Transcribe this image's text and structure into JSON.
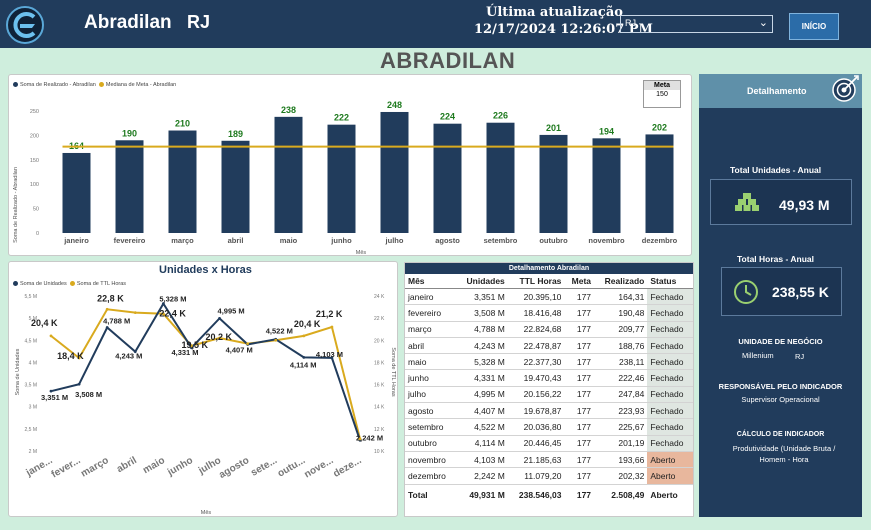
{
  "header": {
    "company": "Abradilan",
    "uf": "RJ",
    "update_label": "Última atualização",
    "update_value": "12/17/2024 12:26:07 PM",
    "filter_value": "RJ",
    "home_button": "INÍCIO"
  },
  "page_title": "ABRADILAN",
  "chart_data": [
    {
      "type": "bar",
      "legend": [
        "Soma de Realizado - Abradilan",
        "Mediana de Meta - Abradilan"
      ],
      "ylabel": "Soma de Realizado - Abradilan",
      "xlabel": "Mês",
      "y_ticks": [
        "0",
        "50",
        "100",
        "150",
        "200",
        "250"
      ],
      "ylim": [
        0,
        250
      ],
      "categories": [
        "janeiro",
        "fevereiro",
        "março",
        "abril",
        "maio",
        "junho",
        "julho",
        "agosto",
        "setembro",
        "outubro",
        "novembro",
        "dezembro"
      ],
      "values": [
        164,
        190,
        210,
        189,
        238,
        222,
        248,
        224,
        226,
        201,
        194,
        202
      ],
      "median_meta": 177,
      "meta_box_label": "Meta",
      "meta_box_value": "150",
      "colors": {
        "bar": "#213c5c",
        "line": "#d9aa1e",
        "label": "#1e7a1e"
      }
    },
    {
      "type": "line",
      "title": "Unidades x Horas",
      "legend": [
        "Soma de Unidades",
        "Soma de TTL Horas"
      ],
      "ylabel_left": "Soma de Unidades",
      "ylabel_right": "Soma de TTL Horas",
      "xlabel": "Mês",
      "y_left_ticks": [
        "2 M",
        "2,5 M",
        "3 M",
        "3,5 M",
        "4 M",
        "4,5 M",
        "5 M",
        "5,5 M"
      ],
      "y_right_ticks": [
        "10 K",
        "12 K",
        "14 K",
        "16 K",
        "18 K",
        "20 K",
        "22 K",
        "24 K"
      ],
      "ylim_left": [
        2.0,
        5.5
      ],
      "ylim_right": [
        10,
        24
      ],
      "x_ticks": [
        "jane...",
        "fever...",
        "março",
        "abril",
        "maio",
        "junho",
        "julho",
        "agosto",
        "sete...",
        "outu...",
        "nove...",
        "deze..."
      ],
      "series": [
        {
          "name": "Soma de Unidades",
          "values": [
            3.351,
            3.508,
            4.788,
            4.243,
            5.328,
            4.331,
            4.995,
            4.407,
            4.522,
            4.114,
            4.103,
            2.242
          ],
          "labels": [
            "3,351 M",
            "3,508 M",
            "4,788 M",
            "4,243 M",
            "5,328 M",
            "4,331 M",
            "4,995 M",
            "4,407 M",
            "4,522 M",
            "4,114 M",
            "4,103 M",
            "2,242 M"
          ],
          "color": "#213c5c"
        },
        {
          "name": "Soma de TTL Horas",
          "values": [
            20.4,
            18.4,
            22.8,
            22.5,
            22.4,
            19.5,
            20.2,
            19.7,
            20.0,
            20.4,
            21.2,
            11.1
          ],
          "labels": [
            "20,4 K",
            "18,4 K",
            "22,8 K",
            "",
            "22,4 K",
            "19,5 K",
            "20,2 K",
            "",
            "",
            "20,4 K",
            "21,2 K",
            ""
          ],
          "color": "#d9aa1e"
        }
      ]
    }
  ],
  "table": {
    "title": "Detalhamento Abradilan",
    "headers": [
      "Mês",
      "Unidades",
      "TTL Horas",
      "Meta",
      "Realizado",
      "Status"
    ],
    "rows": [
      [
        "janeiro",
        "3,351 M",
        "20.395,10",
        "177",
        "164,31",
        "Fechado"
      ],
      [
        "fevereiro",
        "3,508 M",
        "18.416,48",
        "177",
        "190,48",
        "Fechado"
      ],
      [
        "março",
        "4,788 M",
        "22.824,68",
        "177",
        "209,77",
        "Fechado"
      ],
      [
        "abril",
        "4,243 M",
        "22.478,87",
        "177",
        "188,76",
        "Fechado"
      ],
      [
        "maio",
        "5,328 M",
        "22.377,30",
        "177",
        "238,11",
        "Fechado"
      ],
      [
        "junho",
        "4,331 M",
        "19.470,43",
        "177",
        "222,46",
        "Fechado"
      ],
      [
        "julho",
        "4,995 M",
        "20.156,22",
        "177",
        "247,84",
        "Fechado"
      ],
      [
        "agosto",
        "4,407 M",
        "19.678,87",
        "177",
        "223,93",
        "Fechado"
      ],
      [
        "setembro",
        "4,522 M",
        "20.036,80",
        "177",
        "225,67",
        "Fechado"
      ],
      [
        "outubro",
        "4,114 M",
        "20.446,45",
        "177",
        "201,19",
        "Fechado"
      ],
      [
        "novembro",
        "4,103 M",
        "21.185,63",
        "177",
        "193,66",
        "Aberto"
      ],
      [
        "dezembro",
        "2,242 M",
        "11.079,20",
        "177",
        "202,32",
        "Aberto"
      ]
    ],
    "total": [
      "Total",
      "49,931 M",
      "238.546,03",
      "177",
      "2.508,49",
      "Aberto"
    ]
  },
  "side": {
    "header": "Detalhamento",
    "units_label": "Total Unidades - Anual",
    "units_value": "49,93 M",
    "hours_label": "Total Horas - Anual",
    "hours_value": "238,55 K",
    "business_title": "UNIDADE DE NEGÓCIO",
    "business_value": "Millenium",
    "business_uf": "RJ",
    "owner_title": "RESPONSÁVEL PELO INDICADOR",
    "owner_value": "Supervisor Operacional",
    "calc_title": "CÁLCULO DE INDICADOR",
    "calc_value": "Produtividade (Unidade Bruta / Homem - Hora"
  }
}
